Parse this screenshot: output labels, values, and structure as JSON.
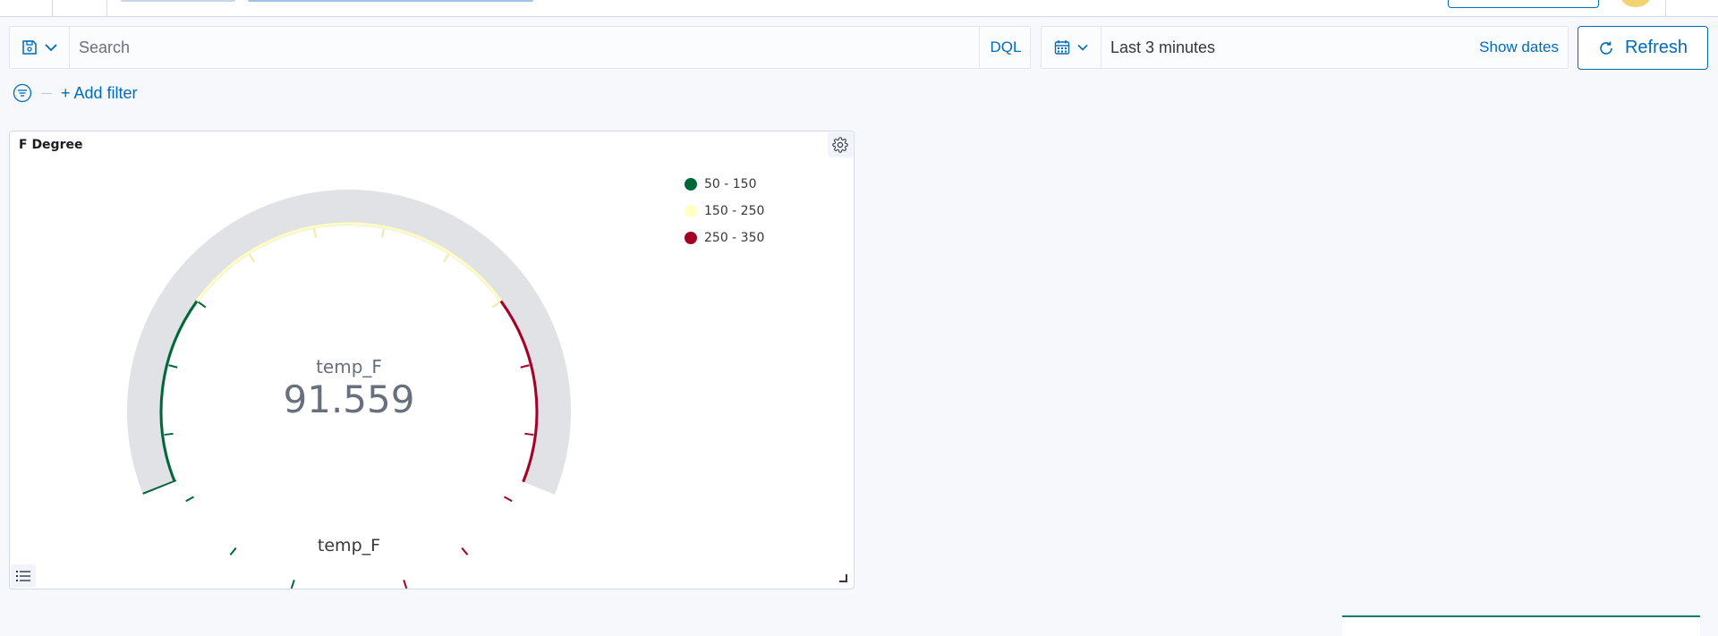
{
  "query_bar": {
    "search_placeholder": "Search",
    "query_language": "DQL"
  },
  "date_picker": {
    "range": "Last 3 minutes",
    "show_dates": "Show dates"
  },
  "refresh": {
    "label": "Refresh"
  },
  "filters": {
    "add_filter": "+ Add filter"
  },
  "panel": {
    "title": "F Degree",
    "metric_label": "temp_F",
    "metric_value": "91.559",
    "axis_label": "temp_F"
  },
  "chart_data": {
    "type": "gauge",
    "value": 91.559,
    "range": [
      50,
      350
    ],
    "bands": [
      {
        "label": "50 - 150",
        "from": 50,
        "to": 150,
        "color": "#006837"
      },
      {
        "label": "150 - 250",
        "from": 150,
        "to": 250,
        "color": "#ffffbf"
      },
      {
        "label": "250 - 350",
        "from": 250,
        "to": 350,
        "color": "#a50026"
      }
    ],
    "track_color": "#e0e2e6",
    "legend_position": "top-right"
  },
  "colors": {
    "accent": "#006bb8",
    "background": "#f7f8fc"
  }
}
